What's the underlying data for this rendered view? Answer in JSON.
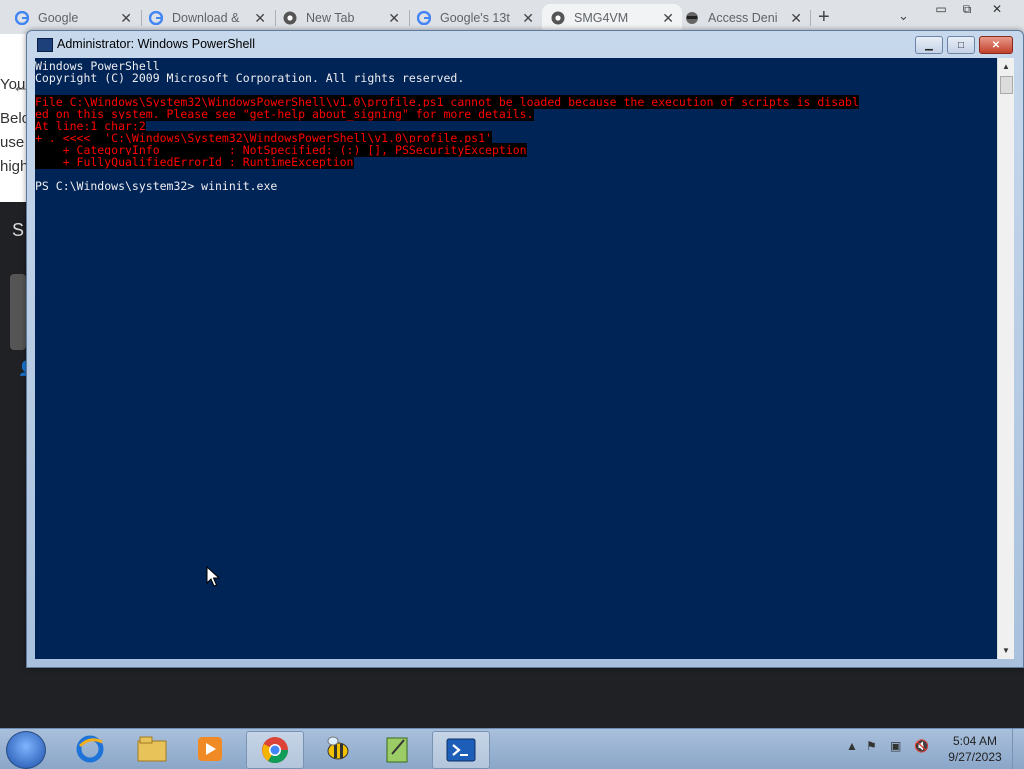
{
  "browser": {
    "tabs": [
      {
        "title": "Google",
        "icon": "google-icon"
      },
      {
        "title": "Download &",
        "icon": "google-icon"
      },
      {
        "title": "New Tab",
        "icon": "chrome-icon"
      },
      {
        "title": "Google's 13t",
        "icon": "google-icon"
      },
      {
        "title": "SMG4VM",
        "icon": "chrome-icon",
        "active": true
      },
      {
        "title": "Access Deni",
        "icon": "spy-icon"
      }
    ]
  },
  "page": {
    "lines": [
      "You",
      "Belo",
      "use",
      "high"
    ],
    "dark_text": "S"
  },
  "powershell": {
    "title": "Administrator: Windows PowerShell",
    "lines": [
      {
        "text": "Windows PowerShell",
        "err": false
      },
      {
        "text": "Copyright (C) 2009 Microsoft Corporation. All rights reserved.",
        "err": false
      },
      {
        "text": "",
        "err": false
      },
      {
        "text": "File C:\\Windows\\System32\\WindowsPowerShell\\v1.0\\profile.ps1 cannot be loaded because the execution of scripts is disabl",
        "err": true
      },
      {
        "text": "ed on this system. Please see \"get-help about_signing\" for more details.",
        "err": true
      },
      {
        "text": "At line:1 char:2",
        "err": true
      },
      {
        "text": "+ . <<<<  'C:\\Windows\\System32\\WindowsPowerShell\\v1.0\\profile.ps1'",
        "err": true
      },
      {
        "text": "    + CategoryInfo          : NotSpecified: (:) [], PSSecurityException",
        "err": true
      },
      {
        "text": "    + FullyQualifiedErrorId : RuntimeException",
        "err": true
      },
      {
        "text": "",
        "err": false
      },
      {
        "text": "PS C:\\Windows\\system32> wininit.exe",
        "err": false
      }
    ]
  },
  "taskbar": {
    "items": [
      "internet-explorer-icon",
      "windows-explorer-icon",
      "media-player-icon",
      "chrome-icon",
      "bee-icon",
      "notepad-icon",
      "powershell-icon"
    ],
    "active_index": 6,
    "clock_time": "5:04 AM",
    "clock_date": "9/27/2023"
  },
  "colors": {
    "console_bg": "#012456",
    "console_fg": "#eeedf0",
    "error_fg": "#ff0000"
  }
}
